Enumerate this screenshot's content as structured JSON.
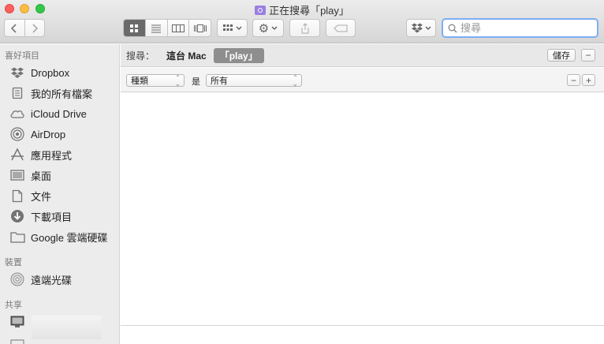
{
  "window": {
    "title": "正在搜尋「play」"
  },
  "toolbar": {
    "back_icon": "chevron-left",
    "forward_icon": "chevron-right",
    "view_modes": [
      "icon-view",
      "list-view",
      "column-view",
      "cover-flow-view"
    ],
    "search_placeholder": "搜尋",
    "search_value": ""
  },
  "sidebar": {
    "favorites_header": "喜好項目",
    "favorites": [
      {
        "label": "Dropbox",
        "icon": "dropbox-icon"
      },
      {
        "label": "我的所有檔案",
        "icon": "all-files-icon"
      },
      {
        "label": "iCloud Drive",
        "icon": "cloud-icon"
      },
      {
        "label": "AirDrop",
        "icon": "airdrop-icon"
      },
      {
        "label": "應用程式",
        "icon": "applications-icon"
      },
      {
        "label": "桌面",
        "icon": "desktop-icon"
      },
      {
        "label": "文件",
        "icon": "document-icon"
      },
      {
        "label": "下載項目",
        "icon": "download-icon"
      },
      {
        "label": "Google 雲端硬碟",
        "icon": "folder-icon"
      }
    ],
    "devices_header": "裝置",
    "devices": [
      {
        "label": "遠端光碟",
        "icon": "disc-icon"
      }
    ],
    "shared_header": "共享"
  },
  "scope": {
    "label": "搜尋：",
    "this_mac": "這台 Mac",
    "current": "「play」",
    "save_label": "儲存",
    "remove_label": "−"
  },
  "criteria": {
    "attribute": "種類",
    "is_label": "是",
    "value": "所有",
    "remove_label": "−",
    "add_label": "+"
  }
}
